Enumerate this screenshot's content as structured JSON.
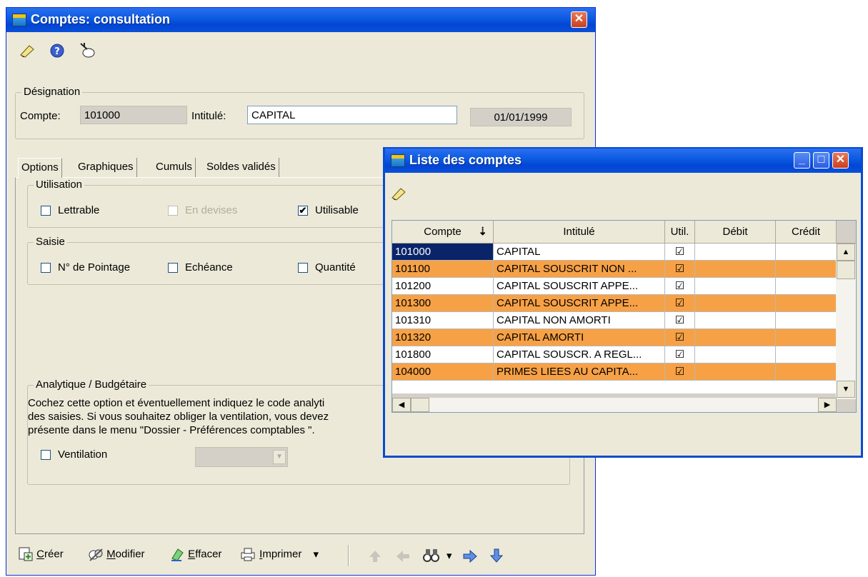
{
  "main_window": {
    "title": "Comptes: consultation",
    "close_glyph": "✕"
  },
  "designation": {
    "legend": "Désignation",
    "compte_label": "Compte:",
    "compte_value": "101000",
    "intitule_label": "Intitulé:",
    "intitule_value": "CAPITAL",
    "date": "01/01/1999"
  },
  "tabs": [
    "Options",
    "Graphiques",
    "Cumuls",
    "Soldes validés"
  ],
  "utilisation": {
    "legend": "Utilisation",
    "lettrable": "Lettrable",
    "en_devises": "En devises",
    "utilisable": "Utilisable",
    "lettrable_checked": false,
    "en_devises_checked": false,
    "utilisable_checked": true
  },
  "saisie": {
    "legend": "Saisie",
    "pointage": "N° de Pointage",
    "echeance": "Echéance",
    "quantite": "Quantité"
  },
  "analytique": {
    "legend": "Analytique / Budgétaire",
    "text_line1": "Cochez cette option et éventuellement indiquez le code analyti",
    "text_line2": "des saisies. Si vous souhaitez obliger la ventilation, vous devez",
    "text_line3": "présente dans le menu \"Dossier - Préférences comptables \".",
    "ventilation": "Ventilation"
  },
  "bottom_toolbar": {
    "creer_u": "C",
    "creer_rest": "réer",
    "modifier_u": "M",
    "modifier_rest": "odifier",
    "effacer_u": "E",
    "effacer_rest": "ffacer",
    "imprimer_u": "I",
    "imprimer_rest": "mprimer",
    "dropdown_glyph": "▾"
  },
  "list_window": {
    "title": "Liste des comptes",
    "minimize_glyph": "_",
    "maximize_glyph": "□",
    "close_glyph": "✕"
  },
  "grid": {
    "columns": [
      "Compte",
      "Intitulé",
      "Util.",
      "Débit",
      "Crédit"
    ],
    "sort_glyph": "⇣",
    "rows": [
      {
        "compte": "101000",
        "intitule": "CAPITAL",
        "util": "☑",
        "style": "selected"
      },
      {
        "compte": "101100",
        "intitule": "CAPITAL SOUSCRIT NON ...",
        "util": "☑",
        "style": "orange"
      },
      {
        "compte": "101200",
        "intitule": "CAPITAL SOUSCRIT APPE...",
        "util": "☑",
        "style": "white"
      },
      {
        "compte": "101300",
        "intitule": "CAPITAL SOUSCRIT APPE...",
        "util": "☑",
        "style": "orange"
      },
      {
        "compte": "101310",
        "intitule": "CAPITAL NON AMORTI",
        "util": "☑",
        "style": "white"
      },
      {
        "compte": "101320",
        "intitule": "CAPITAL AMORTI",
        "util": "☑",
        "style": "orange"
      },
      {
        "compte": "101800",
        "intitule": "CAPITAL SOUSCR. A REGL...",
        "util": "☑",
        "style": "white"
      },
      {
        "compte": "104000",
        "intitule": "PRIMES LIEES AU CAPITA...",
        "util": "☑",
        "style": "orange"
      }
    ],
    "scroll_up": "▲",
    "scroll_down": "▼",
    "scroll_left": "◀",
    "scroll_right": "▶"
  },
  "colors": {
    "orange_row": "#f7a146",
    "selected_row": "#0a246a",
    "title_blue": "#0a5ae0"
  }
}
